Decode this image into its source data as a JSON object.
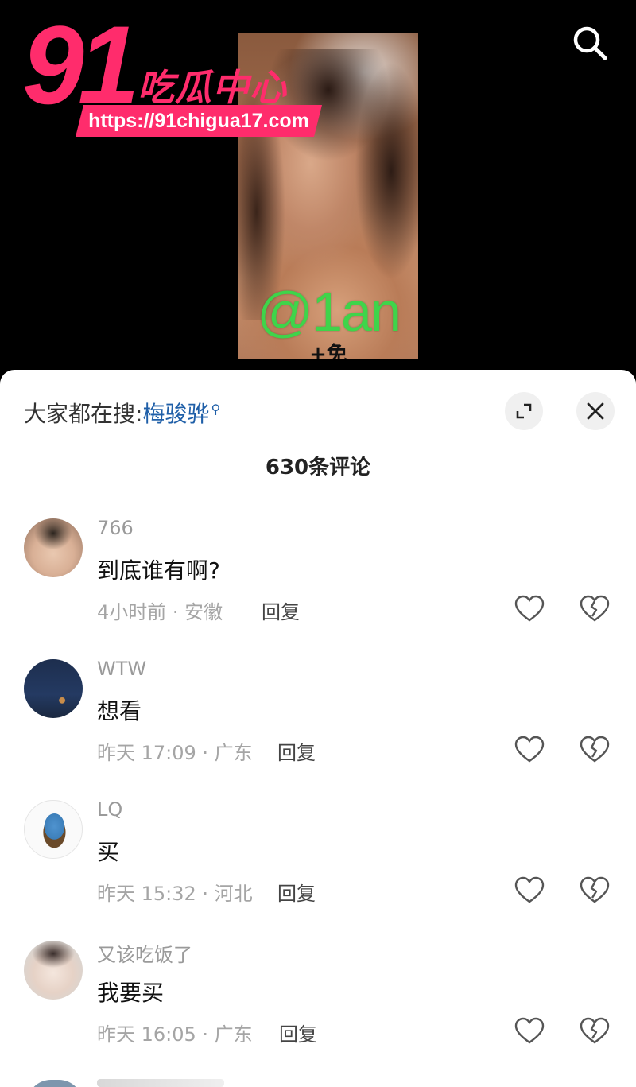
{
  "logo": {
    "number": "91",
    "name": "吃瓜中心",
    "url": "https://91chigua17.com"
  },
  "video": {
    "handle": "@1an",
    "caption": "+免"
  },
  "top_icons": [
    "search-icon"
  ],
  "sheet": {
    "hot_search_prefix": "大家都在搜:",
    "hot_search_term": "梅骏骅",
    "comment_count": "630条评论",
    "icons": [
      "expand-icon",
      "close-icon"
    ]
  },
  "comments": [
    {
      "username": "766",
      "text": "到底谁有啊?",
      "meta": "4小时前 · 安徽",
      "reply": "回复"
    },
    {
      "username": "WTW",
      "text": "想看",
      "meta": "昨天 17:09 · 广东",
      "reply": "回复"
    },
    {
      "username": "LQ",
      "text": "买",
      "meta": "昨天 15:32 · 河北",
      "reply": "回复"
    },
    {
      "username": "又该吃饭了",
      "text": "我要买",
      "meta": "昨天 16:05 · 广东",
      "reply": "回复"
    }
  ],
  "colors": {
    "logo_pink": "#ff2c6c",
    "handle_green": "#3fd44a",
    "link_blue": "#1f5fa8"
  }
}
